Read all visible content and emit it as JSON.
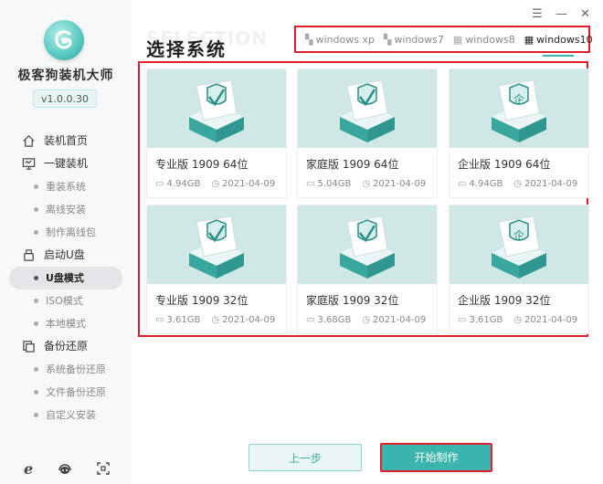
{
  "app": {
    "title": "极客狗装机大师",
    "version": "v1.0.0.30"
  },
  "window_controls": {
    "menu": "☰",
    "minimize": "—",
    "close": "✕"
  },
  "sidebar": {
    "items": [
      {
        "label": "装机首页",
        "icon": "home-icon",
        "type": "main"
      },
      {
        "label": "一键装机",
        "icon": "monitor-icon",
        "type": "main"
      },
      {
        "label": "重装系统",
        "type": "sub"
      },
      {
        "label": "离线安装",
        "type": "sub"
      },
      {
        "label": "制作离线包",
        "type": "sub"
      },
      {
        "label": "启动U盘",
        "icon": "usb-icon",
        "type": "main"
      },
      {
        "label": "U盘模式",
        "type": "sub",
        "active": true
      },
      {
        "label": "ISO模式",
        "type": "sub"
      },
      {
        "label": "本地模式",
        "type": "sub"
      },
      {
        "label": "备份还原",
        "icon": "backup-icon",
        "type": "main"
      },
      {
        "label": "系统备份还原",
        "type": "sub"
      },
      {
        "label": "文件备份还原",
        "type": "sub"
      },
      {
        "label": "自定义安装",
        "type": "sub"
      }
    ]
  },
  "main": {
    "watermark": "SELECTION",
    "title": "选择系统",
    "tabs": [
      {
        "label": "windows xp",
        "active": false
      },
      {
        "label": "windows7",
        "active": false
      },
      {
        "label": "windows8",
        "active": false
      },
      {
        "label": "windows10",
        "active": true
      }
    ],
    "cards": [
      {
        "name": "专业版 1909 64位",
        "size": "4.94GB",
        "date": "2021-04-09",
        "badge": "check"
      },
      {
        "name": "家庭版 1909 64位",
        "size": "5.04GB",
        "date": "2021-04-09",
        "badge": "check"
      },
      {
        "name": "企业版 1909 64位",
        "size": "4.94GB",
        "date": "2021-04-09",
        "badge": "企"
      },
      {
        "name": "专业版 1909 32位",
        "size": "3.61GB",
        "date": "2021-04-09",
        "badge": "check"
      },
      {
        "name": "家庭版 1909 32位",
        "size": "3.68GB",
        "date": "2021-04-09",
        "badge": "check"
      },
      {
        "name": "企业版 1909 32位",
        "size": "3.61GB",
        "date": "2021-04-09",
        "badge": "企"
      }
    ]
  },
  "buttons": {
    "prev": "上一步",
    "start": "开始制作"
  },
  "colors": {
    "accent": "#3ab5ad",
    "highlight_border": "#e0202a",
    "thumb_bg": "#cfe8e6"
  }
}
